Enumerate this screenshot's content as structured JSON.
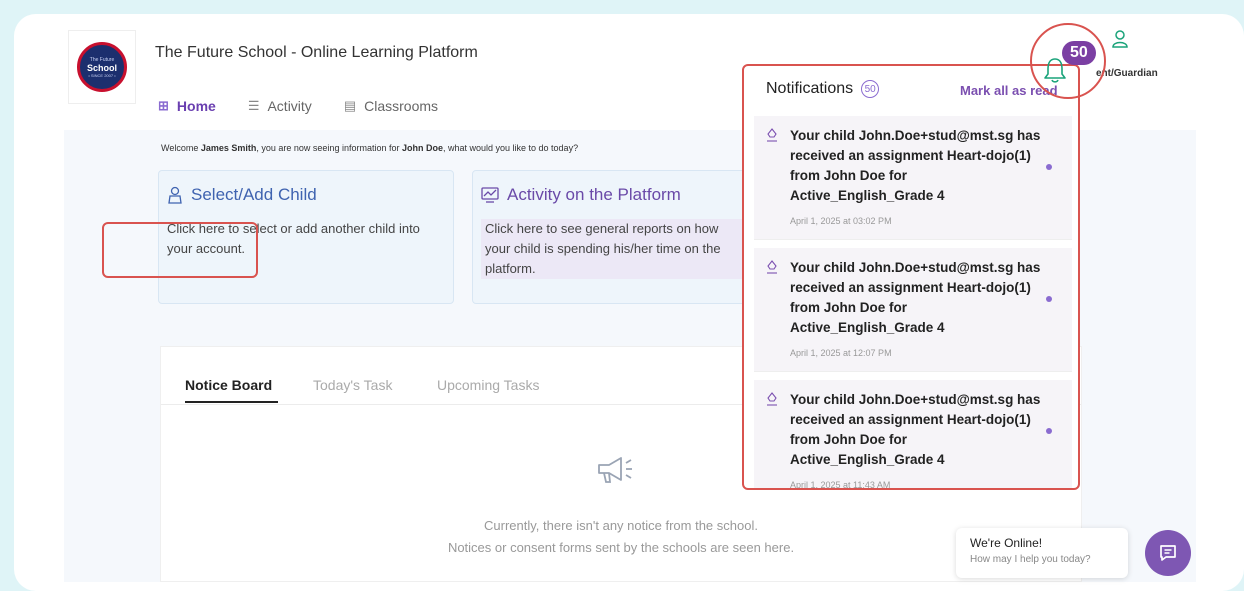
{
  "header": {
    "app_title": "The Future School - Online Learning Platform",
    "logo_text": "School",
    "logo_top": "The Future",
    "logo_bottom": "• SINCE 2007 •",
    "user_role": "ent/Guardian",
    "notif_badge": "50"
  },
  "nav": {
    "items": [
      {
        "label": "Home",
        "icon": "grid-icon",
        "active": true
      },
      {
        "label": "Activity",
        "icon": "list-icon"
      },
      {
        "label": "Classrooms",
        "icon": "document-icon"
      }
    ]
  },
  "welcome": {
    "prefix": "Welcome ",
    "parent": "James Smith",
    "middle": ", you are now seeing information for ",
    "child": "John Doe",
    "suffix": ", what would you like to do today?"
  },
  "cards": [
    {
      "title": "Select/Add Child",
      "desc": "Click here to select or add another child into your account.",
      "icon": "child-icon"
    },
    {
      "title": "Activity on the Platform",
      "desc": "Click here to see general reports on how your child is spending his/her time on the platform.",
      "icon": "chart-icon"
    }
  ],
  "board": {
    "tabs": [
      "Notice Board",
      "Today's Task",
      "Upcoming Tasks"
    ],
    "empty_line1": "Currently, there isn't any notice from the school.",
    "empty_line2": "Notices or consent forms sent by the schools are seen here."
  },
  "notifications": {
    "title": "Notifications",
    "count": "50",
    "mark_all": "Mark all as read",
    "items": [
      {
        "message": "Your child John.Doe+stud@mst.sg has received an assignment Heart-dojo(1) from John Doe for Active_English_Grade 4",
        "time": "April 1, 2025 at 03:02 PM"
      },
      {
        "message": "Your child John.Doe+stud@mst.sg has received an assignment Heart-dojo(1) from John Doe for Active_English_Grade 4",
        "time": "April 1, 2025 at 12:07 PM"
      },
      {
        "message": "Your child John.Doe+stud@mst.sg has received an assignment Heart-dojo(1) from John Doe for Active_English_Grade 4",
        "time": "April 1, 2025 at 11:43 AM"
      }
    ]
  },
  "chat": {
    "line1": "We're Online!",
    "line2": "How may I help you today?"
  },
  "colors": {
    "accent_purple": "#7b3fa3",
    "accent_green": "#1aa37a",
    "highlight_red": "#d9534f"
  }
}
